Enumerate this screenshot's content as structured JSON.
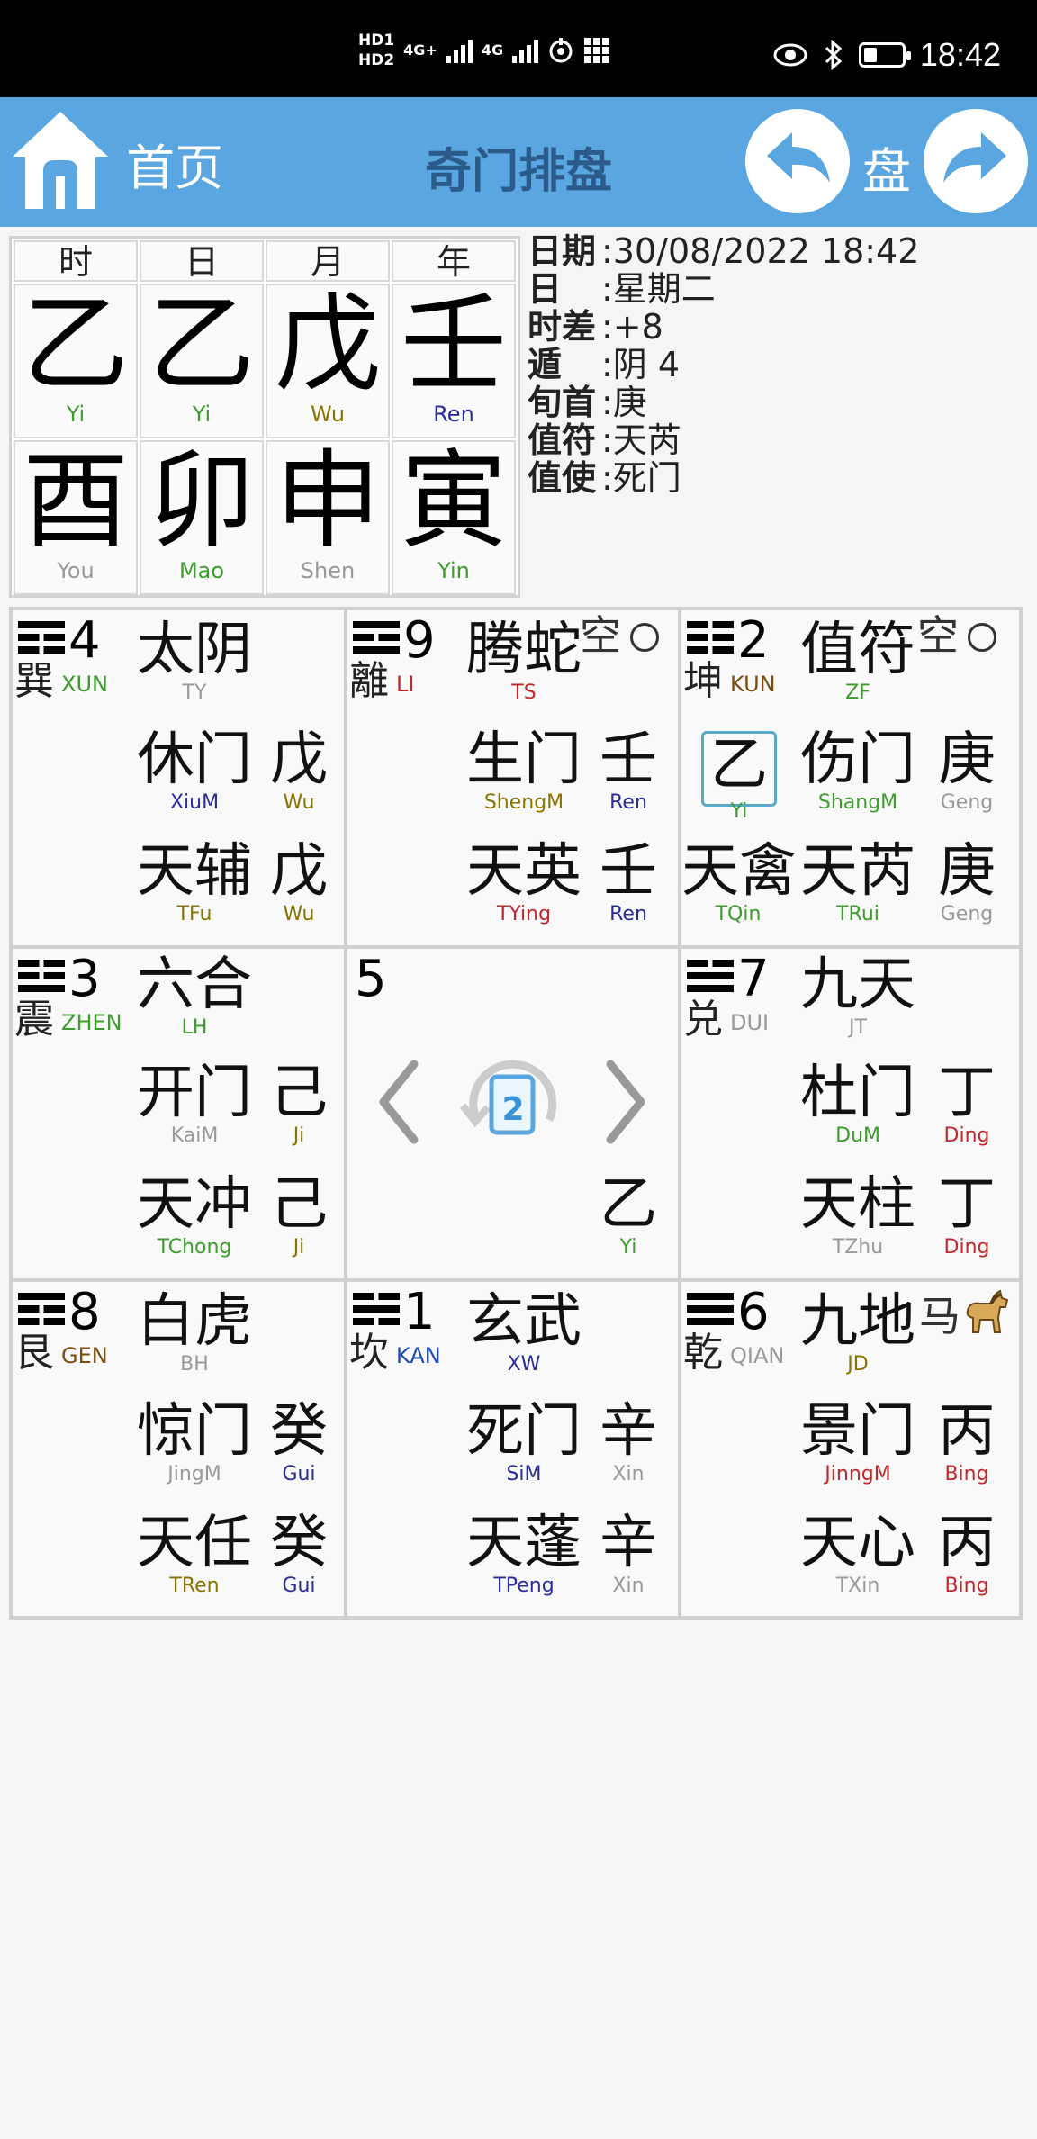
{
  "status_bar": {
    "hd_top": "HD1",
    "hd_bottom": "HD2",
    "net1": "4G+",
    "net2": "4G",
    "battery_level": 0.3,
    "time": "18:42",
    "icons": [
      "eye-icon",
      "bluetooth-icon",
      "battery-icon",
      "nfc-icon",
      "grid-icon"
    ]
  },
  "header": {
    "home_label": "首页",
    "title": "奇门排盘",
    "pan_label": "盘"
  },
  "pillars": {
    "headers": [
      "时",
      "日",
      "月",
      "年"
    ],
    "stems": [
      {
        "char": "乙",
        "py": "Yi",
        "color": "#3c9c2c"
      },
      {
        "char": "乙",
        "py": "Yi",
        "color": "#3c9c2c"
      },
      {
        "char": "戊",
        "py": "Wu",
        "color": "#8a7400"
      },
      {
        "char": "壬",
        "py": "Ren",
        "color": "#2a2d99"
      }
    ],
    "branches": [
      {
        "char": "酉",
        "py": "You",
        "color": "#999999"
      },
      {
        "char": "卯",
        "py": "Mao",
        "color": "#3c9c2c"
      },
      {
        "char": "申",
        "py": "Shen",
        "color": "#999999"
      },
      {
        "char": "寅",
        "py": "Yin",
        "color": "#3c9c2c"
      }
    ]
  },
  "info": [
    {
      "k": "日期",
      "v": ":30/08/2022 18:42"
    },
    {
      "k": "日",
      "v": " :星期二"
    },
    {
      "k": "时差",
      "v": ":+8"
    },
    {
      "k": "遁",
      "v": " :阴 4"
    },
    {
      "k": "旬首",
      "v": ":庚"
    },
    {
      "k": "值符",
      "v": ":天芮"
    },
    {
      "k": "值使",
      "v": ":死门"
    }
  ],
  "palaces": {
    "xun": {
      "num": "4",
      "char": "巽",
      "py": "XUN",
      "deity": "太阴",
      "deity_py": "TY",
      "door": "休门",
      "door_py": "XiuM",
      "d_stem": "戊",
      "d_stem_py": "Wu",
      "star": "天辅",
      "star_py": "TFu",
      "s_stem": "戊",
      "s_stem_py": "Wu"
    },
    "li": {
      "num": "9",
      "char": "離",
      "py": "LI",
      "deity": "腾蛇",
      "deity_py": "TS",
      "kong": "空",
      "door": "生门",
      "door_py": "ShengM",
      "d_stem": "壬",
      "d_stem_py": "Ren",
      "star": "天英",
      "star_py": "TYing",
      "s_stem": "壬",
      "s_stem_py": "Ren"
    },
    "kun": {
      "num": "2",
      "char": "坤",
      "py": "KUN",
      "deity": "值符",
      "deity_py": "ZF",
      "kong": "空",
      "extra": "乙",
      "extra_py": "Yi",
      "door": "伤门",
      "door_py": "ShangM",
      "d_stem": "庚",
      "d_stem_py": "Geng",
      "star2": "天禽",
      "star2_py": "TQin",
      "star": "天芮",
      "star_py": "TRui",
      "s_stem": "庚",
      "s_stem_py": "Geng"
    },
    "zhen": {
      "num": "3",
      "char": "震",
      "py": "ZHEN",
      "deity": "六合",
      "deity_py": "LH",
      "door": "开门",
      "door_py": "KaiM",
      "d_stem": "己",
      "d_stem_py": "Ji",
      "star": "天冲",
      "star_py": "TChong",
      "s_stem": "己",
      "s_stem_py": "Ji"
    },
    "center": {
      "num": "5",
      "badge": "2",
      "stem": "乙",
      "stem_py": "Yi"
    },
    "dui": {
      "num": "7",
      "char": "兑",
      "py": "DUI",
      "deity": "九天",
      "deity_py": "JT",
      "door": "杜门",
      "door_py": "DuM",
      "d_stem": "丁",
      "d_stem_py": "Ding",
      "star": "天柱",
      "star_py": "TZhu",
      "s_stem": "丁",
      "s_stem_py": "Ding"
    },
    "gen": {
      "num": "8",
      "char": "艮",
      "py": "GEN",
      "deity": "白虎",
      "deity_py": "BH",
      "door": "惊门",
      "door_py": "JingM",
      "d_stem": "癸",
      "d_stem_py": "Gui",
      "star": "天任",
      "star_py": "TRen",
      "s_stem": "癸",
      "s_stem_py": "Gui"
    },
    "kan": {
      "num": "1",
      "char": "坎",
      "py": "KAN",
      "deity": "玄武",
      "deity_py": "XW",
      "door": "死门",
      "door_py": "SiM",
      "d_stem": "辛",
      "d_stem_py": "Xin",
      "star": "天蓬",
      "star_py": "TPeng",
      "s_stem": "辛",
      "s_stem_py": "Xin"
    },
    "qian": {
      "num": "6",
      "char": "乾",
      "py": "QIAN",
      "deity": "九地",
      "deity_py": "JD",
      "ma": "马",
      "door": "景门",
      "door_py": "JinngM",
      "d_stem": "丙",
      "d_stem_py": "Bing",
      "star": "天心",
      "star_py": "TXin",
      "s_stem": "丙",
      "s_stem_py": "Bing"
    }
  },
  "colors": {
    "appbar": "#5aa6e0",
    "title": "#2a5b8a",
    "green": "#3c9c2c",
    "olive": "#8a7400",
    "navy": "#2a2d99",
    "red": "#c0282c",
    "gray": "#999999"
  }
}
